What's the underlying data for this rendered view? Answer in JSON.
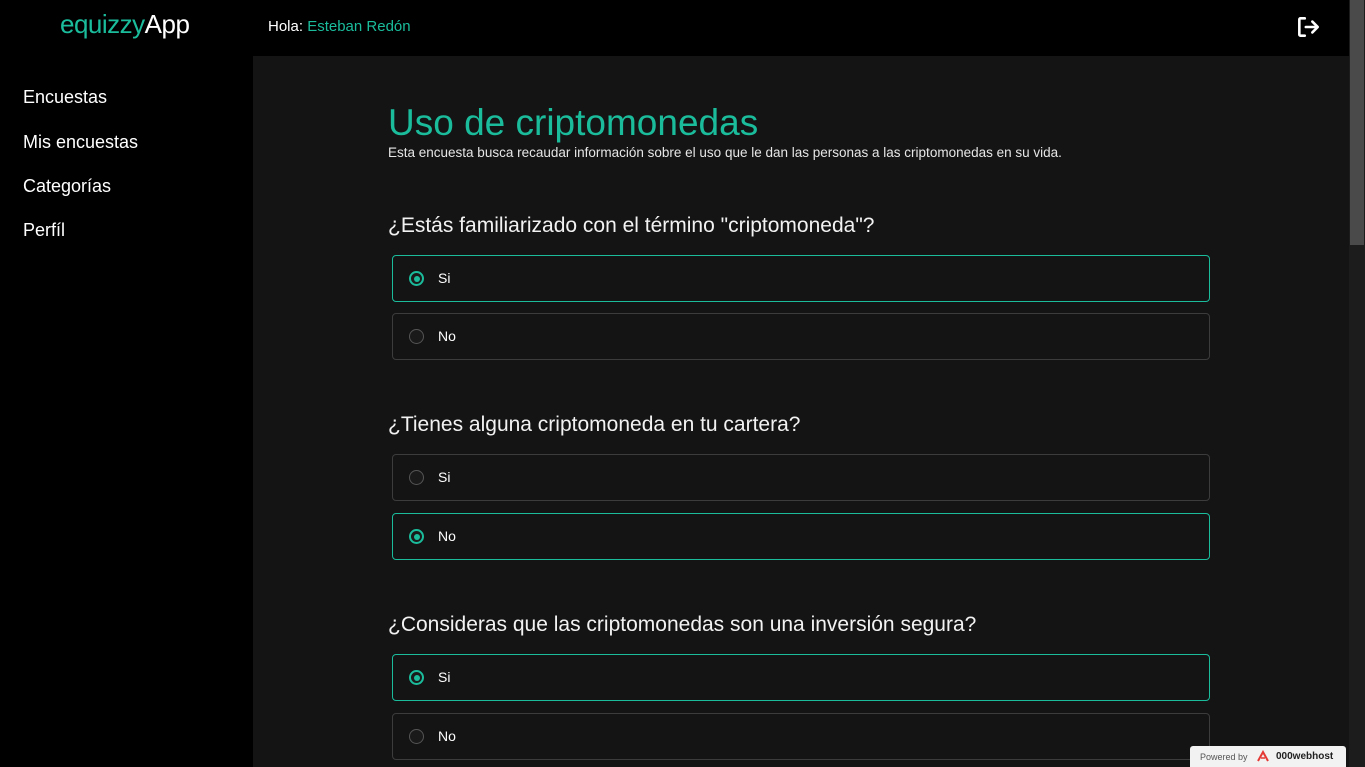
{
  "brand": {
    "part1": "equizzy",
    "part2": "App"
  },
  "header": {
    "greeting_label": "Hola:",
    "user_name": "Esteban Redón"
  },
  "sidebar": {
    "items": [
      {
        "label": "Encuestas"
      },
      {
        "label": "Mis encuestas"
      },
      {
        "label": "Categorías"
      },
      {
        "label": "Perfíl"
      }
    ]
  },
  "survey": {
    "title": "Uso de criptomonedas",
    "description": "Esta encuesta busca recaudar información sobre el uso que le dan las personas a las criptomonedas en su vida.",
    "questions": [
      {
        "text": "¿Estás familiarizado con el término \"criptomoneda\"?",
        "options": [
          {
            "label": "Si",
            "selected": true
          },
          {
            "label": "No",
            "selected": false
          }
        ]
      },
      {
        "text": "¿Tienes alguna criptomoneda en tu cartera?",
        "options": [
          {
            "label": "Si",
            "selected": false
          },
          {
            "label": "No",
            "selected": true
          }
        ]
      },
      {
        "text": "¿Consideras que las criptomonedas son una inversión segura?",
        "options": [
          {
            "label": "Si",
            "selected": true
          },
          {
            "label": "No",
            "selected": false
          }
        ]
      }
    ]
  },
  "footer_badge": {
    "powered_by": "Powered by",
    "host": "000webhost"
  },
  "colors": {
    "accent": "#1abc9c",
    "background": "#000000",
    "content_bg": "#141414"
  },
  "icons": {
    "logout": "logout-icon"
  }
}
